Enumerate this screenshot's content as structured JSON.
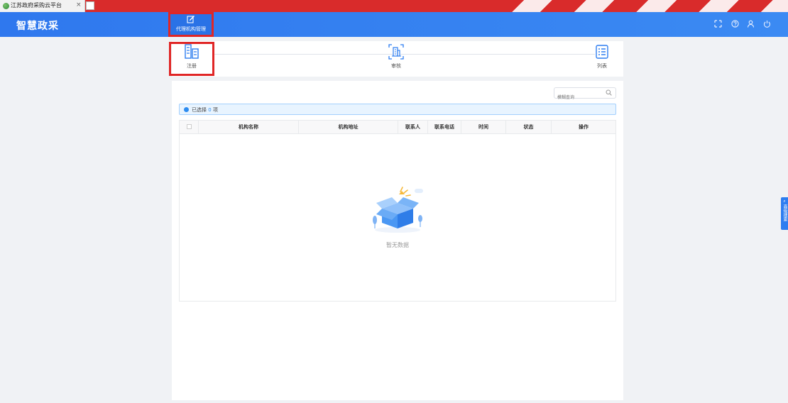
{
  "browser": {
    "tab_title": "江苏政府采购云平台",
    "tab_close": "×"
  },
  "header": {
    "logo": "智慧政采",
    "menu": [
      {
        "label": "代理机构管理",
        "icon": "edit-square-icon"
      }
    ],
    "right_icons": [
      "fullscreen-icon",
      "help-icon",
      "user-icon",
      "power-icon"
    ]
  },
  "steps": [
    {
      "label": "注册",
      "icon": "register-form-icon"
    },
    {
      "label": "审核",
      "icon": "audit-building-icon"
    },
    {
      "label": "列表",
      "icon": "list-icon"
    }
  ],
  "search": {
    "placeholder": "模糊查询"
  },
  "selection": {
    "prefix": "已选择",
    "count": "0",
    "suffix": "项"
  },
  "table": {
    "columns": [
      "机构名称",
      "机构地址",
      "联系人",
      "联系电话",
      "时间",
      "状态",
      "操作"
    ],
    "rows": [],
    "empty_text": "暂无数据"
  },
  "side_tab": {
    "label": "高级搜索"
  },
  "colors": {
    "primary": "#2f78ee",
    "highlight": "#e02626",
    "alert_bg": "#e8f4ff"
  }
}
